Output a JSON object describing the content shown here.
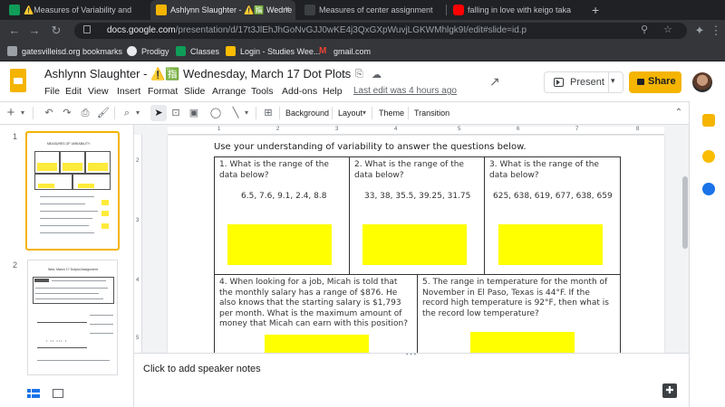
{
  "browser": {
    "tabs": [
      {
        "title": "⚠️Measures of Variability and",
        "active": false
      },
      {
        "title": "Ashlynn Slaughter - ⚠️🈯 Wedne",
        "active": true
      },
      {
        "title": "Measures of center assignment",
        "active": false
      },
      {
        "title": "falling in love with keigo taka",
        "active": false
      }
    ],
    "new_tab": "+",
    "close": "×",
    "url_host": "docs.google.com",
    "url_path": "/presentation/d/17t3JlEhJhGoNvGJJ0wKE4j3QxGXpWuvjLGKWMhlgk9I/edit#slide=id.p",
    "bookmarks": [
      {
        "label": "gatesvilleisd.org bookmarks"
      },
      {
        "label": "Prodigy"
      },
      {
        "label": "Classes"
      },
      {
        "label": "Login - Studies Wee..."
      },
      {
        "label": "gmail.com"
      }
    ]
  },
  "app": {
    "title": "Ashlynn Slaughter - ⚠️🈯 Wednesday, March 17 Dot Plots",
    "menu": [
      "File",
      "Edit",
      "View",
      "Insert",
      "Format",
      "Slide",
      "Arrange",
      "Tools",
      "Add-ons",
      "Help"
    ],
    "last_edit": "Last edit was 4 hours ago",
    "present_label": "Present",
    "share_label": "Share",
    "brand_color": "#f4b400"
  },
  "toolbar": {
    "background": "Background",
    "layout": "Layout",
    "theme": "Theme",
    "transition": "Transition"
  },
  "filmstrip": {
    "slides": [
      "1",
      "2"
    ],
    "thumb1_title": "MEASURES OF VARIABILITY",
    "thumb2_title": "Wed, March 17 Dotplot Assignment"
  },
  "ruler": {
    "top": [
      "1",
      "2",
      "3",
      "4",
      "5",
      "6",
      "7",
      "8"
    ],
    "left": [
      "2",
      "3",
      "4",
      "5"
    ]
  },
  "slide": {
    "instruction": "Use your understanding of variability to answer the questions below.",
    "q1": {
      "text": "1.  What is the range of the data below?",
      "data": "6.5, 7.6, 9.1, 2.4, 8.8"
    },
    "q2": {
      "text": "2.  What is the range of the data below?",
      "data": "33, 38, 35.5, 39.25, 31.75"
    },
    "q3": {
      "text": "3.  What is the range of the data below?",
      "data": "625, 638, 619, 677, 638, 659"
    },
    "q4": {
      "text": "4.  When looking for a job, Micah is told that the monthly salary has a range of $876.  He also knows that the starting salary is $1,793 per month.  What is the maximum amount of money that Micah can earn with this position?"
    },
    "q5": {
      "text": "5.  The range in temperature for the month of November in El Paso, Texas is 44°F.  If the record high temperature is 92°F, then what is the record low temperature?"
    },
    "answer_color": "#ffff00"
  },
  "notes": {
    "placeholder": "Click to add speaker notes"
  }
}
